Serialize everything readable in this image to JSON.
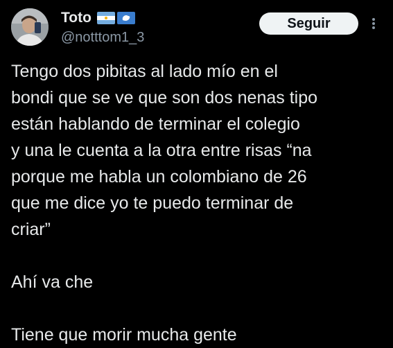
{
  "author": {
    "display_name": "Toto",
    "handle": "@notttom1_3",
    "flag_icons": [
      "argentina-flag-icon",
      "antarctica-flag-icon"
    ]
  },
  "actions": {
    "follow_label": "Seguir",
    "more_icon": "vertical-ellipsis-icon"
  },
  "tweet": {
    "paragraphs": [
      [
        "Tengo dos pibitas al lado mío en el",
        "bondi que se ve que son dos nenas tipo",
        "están hablando de terminar el colegio",
        "y una le cuenta a la otra entre risas “na",
        "porque me habla un colombiano de 26",
        "que me dice yo te puedo terminar de",
        "criar”"
      ],
      [
        "Ahí va che"
      ],
      [
        "Tiene que morir mucha gente"
      ]
    ]
  },
  "colors": {
    "background": "#000000",
    "text": "#e7e9ea",
    "secondary_text": "#8b98a5",
    "button_bg": "#eff3f4",
    "button_text": "#0f1419"
  }
}
